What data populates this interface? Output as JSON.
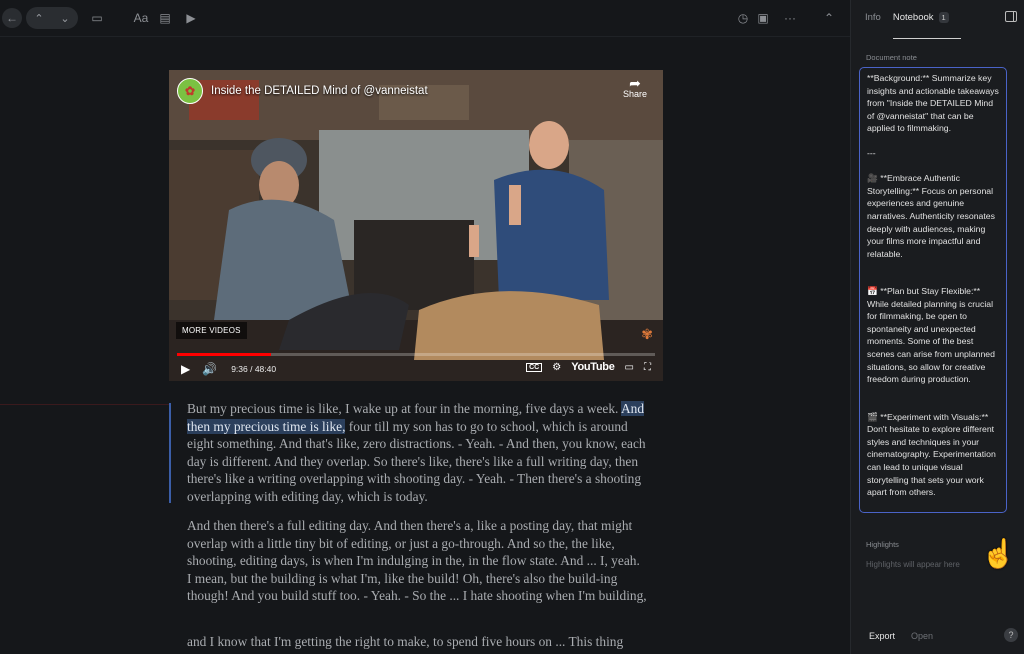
{
  "toolbar": {
    "back_icon": "←",
    "up_icon": "⌃",
    "down_icon": "⌄",
    "sidebar_icon": "▭",
    "font_label": "Aa",
    "doc_icon": "▤",
    "video_icon": "▶",
    "clock_icon": "◷",
    "archive_icon": "▣",
    "more_icon": "···",
    "collapse_icon": "⌃"
  },
  "video": {
    "title": "Inside the DETAILED Mind of @vanneistat",
    "share_label": "Share",
    "more_videos": "MORE VIDEOS",
    "time": "9:36 / 48:40",
    "progress": 0.197,
    "brand": "YouTube",
    "cc_label": "CC"
  },
  "transcript": {
    "p1_a": "But my precious time is like, I wake up at four in the morning, five days a week. ",
    "p1_hl": "And then my precious time is like,",
    "p1_b": " four till my son has to go to school, which is around eight something. And that's like, zero distractions. - Yeah. - And then, you know, each day is different. And they overlap. So there's like, there's like a full writing day, then there's like a writing overlapping with shooting day. - Yeah. - Then there's a shooting overlapping with editing day, which is today.",
    "p2": "And then there's a full editing day. And then there's a, like a posting day, that might overlap with a little tiny bit of editing, or just a go-through. And so the, the like, shooting, editing days, is when I'm indulging in the, in the flow state. And ... I, yeah. I mean, but the building is what I'm, like the build! Oh, there's also the build-ing though! And you build stuff too. - Yeah. - So the ... I hate shooting when I'm building,",
    "p3": "and I know that I'm getting the right to make, to spend five hours on ... This thing"
  },
  "panel": {
    "tab_info": "Info",
    "tab_notebook": "Notebook",
    "notebook_count": "1",
    "doc_note_label": "Document note",
    "note_text": "**Background:** Summarize key insights and actionable takeaways from \"Inside the DETAILED Mind of @vanneistat\" that can be applied to filmmaking.\n\n---\n\n🎥 **Embrace Authentic Storytelling:** Focus on personal experiences and genuine narratives. Authenticity resonates deeply with audiences, making your films more impactful and relatable.\n\n\n📅 **Plan but Stay Flexible:** While detailed planning is crucial for filmmaking, be open to spontaneity and unexpected moments. Some of the best scenes can arise from unplanned situations, so allow for creative freedom during production.\n\n\n🎬 **Experiment with Visuals:** Don't hesitate to explore different styles and techniques in your cinematography. Experimentation can lead to unique visual storytelling that sets your work apart from others.",
    "highlights_label": "Highlights",
    "highlights_empty": "Highlights will appear here",
    "export_label": "Export",
    "open_label": "Open",
    "help_label": "?"
  },
  "colors": {
    "background": "#15171a",
    "panel": "#1a1c1f",
    "accent_border": "#4a63c8",
    "highlight": "#2b3f5c",
    "progress_red": "#ff0000"
  }
}
